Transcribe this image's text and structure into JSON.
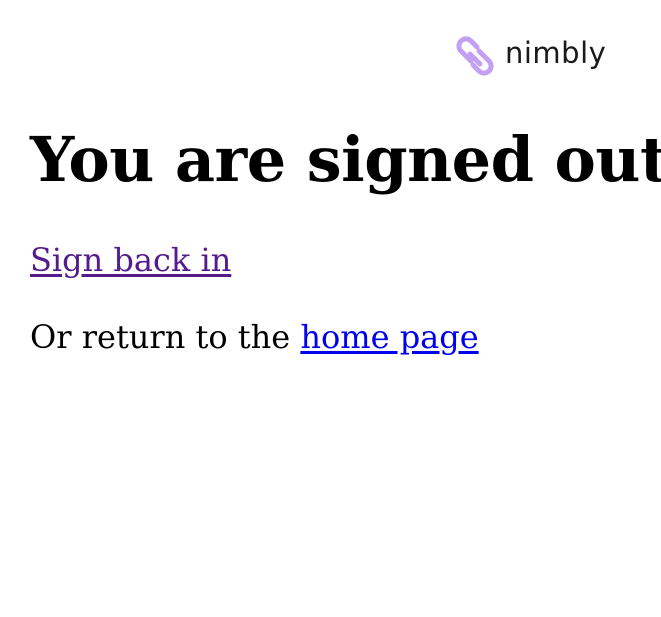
{
  "logo": {
    "text": "nimbly",
    "accent_color": "#c4a0f5"
  },
  "main": {
    "heading": "You are signed out",
    "sign_in_link": "Sign back in",
    "return_prefix": "Or return to the ",
    "home_link": "home page"
  },
  "colors": {
    "visited_link": "#551a8b",
    "link": "#0000ee"
  }
}
